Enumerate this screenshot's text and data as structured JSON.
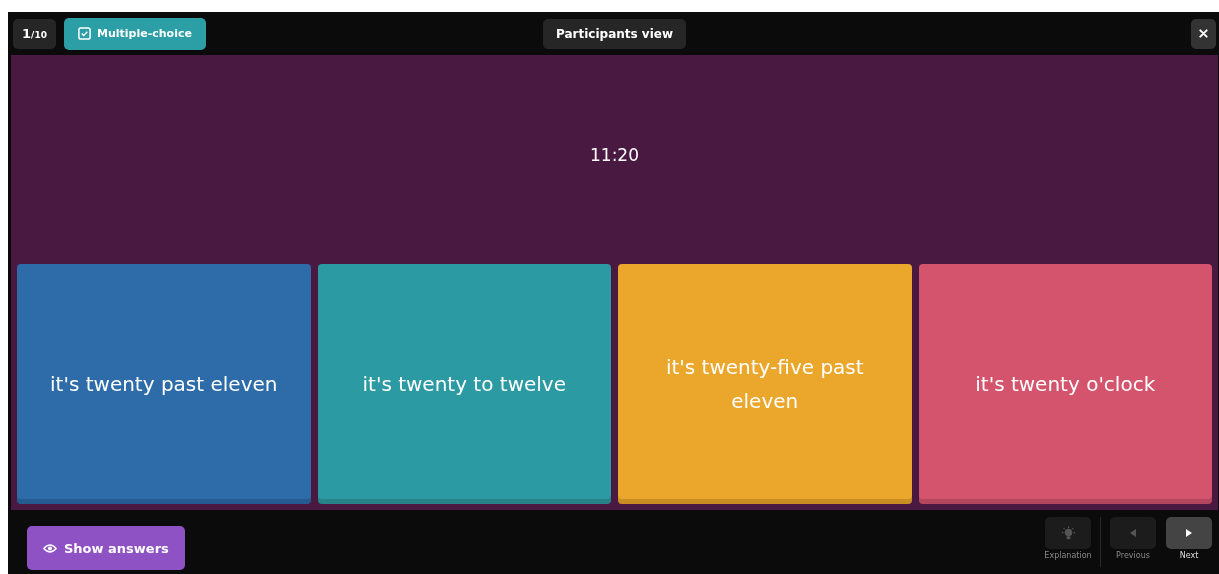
{
  "counter": {
    "current": "1",
    "total": "/10"
  },
  "question_type": "Multiple-choice",
  "view_button": "Participants view",
  "question": "11:20",
  "answers": [
    {
      "text": "it's twenty past eleven",
      "color": "#2d6ca8"
    },
    {
      "text": "it's twenty to twelve",
      "color": "#2c9aa2"
    },
    {
      "text": "it's twenty-five past eleven",
      "color": "#eba72b"
    },
    {
      "text": "it's twenty o'clock",
      "color": "#d4546e"
    }
  ],
  "show_answers": "Show answers",
  "nav": [
    {
      "kind": "explanation",
      "label": "Explanation",
      "disabled": true
    },
    {
      "kind": "previous",
      "label": "Previous",
      "disabled": true
    },
    {
      "kind": "next",
      "label": "Next",
      "disabled": false
    }
  ]
}
